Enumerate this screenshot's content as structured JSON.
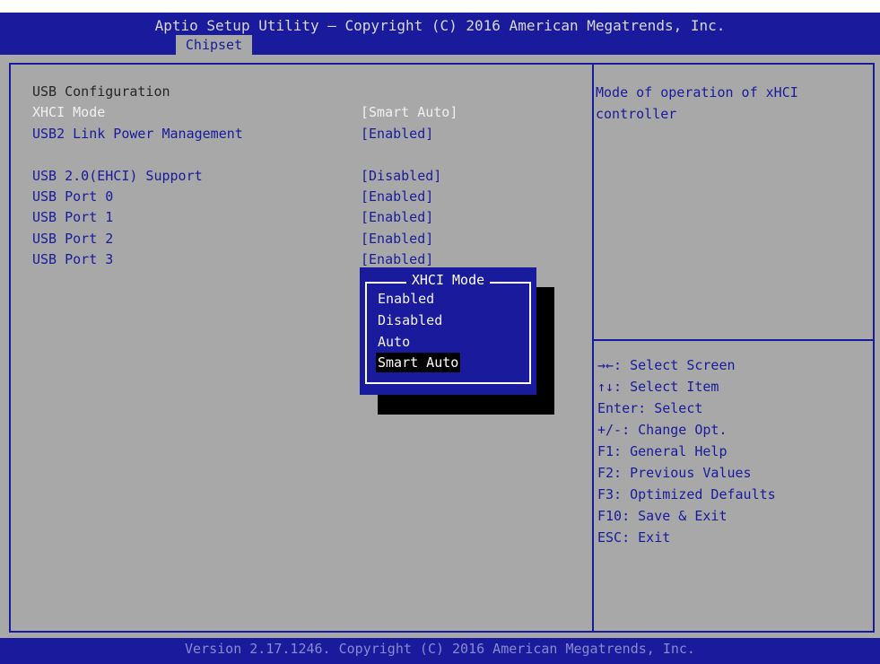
{
  "header": {
    "title": "Aptio Setup Utility – Copyright (C) 2016 American Megatrends, Inc.",
    "active_tab": "Chipset"
  },
  "main": {
    "section_title": "USB Configuration",
    "rows": [
      {
        "label": "XHCI Mode",
        "value": "[Smart Auto]"
      },
      {
        "label": "USB2 Link Power Management",
        "value": "[Enabled]"
      },
      {
        "label": "USB 2.0(EHCI) Support",
        "value": "[Disabled]"
      },
      {
        "label": "USB Port 0",
        "value": "[Enabled]"
      },
      {
        "label": "USB Port 1",
        "value": "[Enabled]"
      },
      {
        "label": "USB Port 2",
        "value": "[Enabled]"
      },
      {
        "label": "USB Port 3",
        "value": "[Enabled]"
      }
    ]
  },
  "help": {
    "text": "Mode of operation of xHCI\ncontroller"
  },
  "keys": [
    "→←: Select Screen",
    "↑↓: Select Item",
    "Enter: Select",
    "+/-: Change Opt.",
    "F1: General Help",
    "F2: Previous Values",
    "F3: Optimized Defaults",
    "F10: Save & Exit",
    "ESC: Exit"
  ],
  "popup": {
    "title": "XHCI Mode",
    "options": [
      "Enabled",
      "Disabled",
      "Auto",
      "Smart Auto"
    ],
    "selected": "Smart Auto"
  },
  "footer": {
    "text": "Version 2.17.1246. Copyright (C) 2016 American Megatrends, Inc."
  },
  "colors": {
    "bios_blue": "#1a1a9c",
    "panel_gray": "#a8a8a8",
    "highlight_text": "#f0f0f0"
  }
}
